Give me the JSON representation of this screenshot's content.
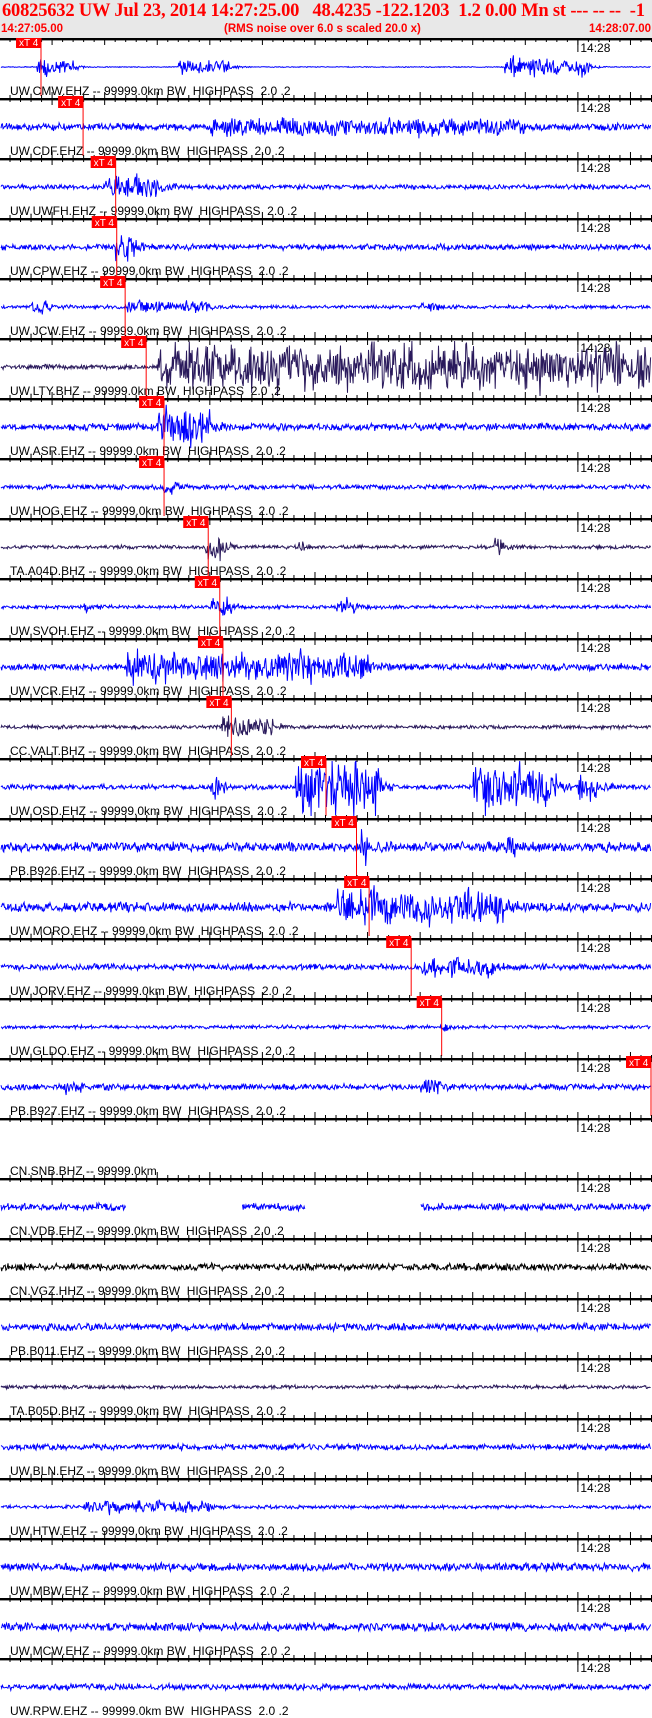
{
  "header": {
    "title": "60825632 UW Jul 23, 2014 14:27:25.00   48.4235 -122.1203  1.2 0.00 Mn st --- -- --  -1",
    "start_time": "14:27:05.00",
    "note": "(RMS noise over 6.0 s scaled 20.0 x)",
    "end_time": "14:28:07.00"
  },
  "chart_data": {
    "type": "line",
    "title": "60825632 UW Jul 23, 2014 14:27:25.00   48.4235 -122.1203  1.2 0.00 Mn st --- -- --  -1",
    "x_axis": {
      "start": "14:27:05.00",
      "end": "14:28:07.00",
      "duration_s": 62,
      "major_tick_s": 5,
      "minor_tick_s": 1,
      "minute_label": "14:28",
      "minute_label_offset_s": 55
    },
    "pick_label": "xT 4",
    "colors": {
      "blue": "#0000ff",
      "dark": "#2a1a5c",
      "black": "#000000",
      "pick": "#ff0000",
      "header_bg": "#e8e8e8"
    },
    "traces": [
      {
        "label": "UW.CMW.EHZ -- 99999.0km BW  HIGHPASS  2.0 .2",
        "color": "blue",
        "noise": 0.4,
        "bursts": [
          [
            3.5,
            7,
            9
          ],
          [
            17,
            22,
            7
          ],
          [
            48,
            56,
            9
          ]
        ],
        "pick_s": 3.9
      },
      {
        "label": "UW.CDF.EHZ -- 99999.0km BW  HIGHPASS  2.0 .2",
        "color": "blue",
        "noise": 3,
        "bursts": [
          [
            20,
            50,
            6
          ]
        ],
        "pick_s": 7.9
      },
      {
        "label": "UW.UWFH.EHZ -- 99999.0km BW  HIGHPASS  2.0 .2",
        "color": "blue",
        "noise": 2,
        "bursts": [
          [
            10,
            16,
            10
          ]
        ],
        "pick_s": 11.0
      },
      {
        "label": "UW.CPW.EHZ -- 99999.0km BW  HIGHPASS  2.0 .2",
        "color": "blue",
        "noise": 2.5,
        "bursts": [
          [
            11,
            13,
            12
          ]
        ],
        "pick_s": 11.1
      },
      {
        "label": "UW.JCW.EHZ -- 99999.0km BW  HIGHPASS  2.0 .2",
        "color": "blue",
        "noise": 1.5,
        "bursts": [
          [
            12,
            20,
            5
          ],
          [
            3,
            5,
            5
          ],
          [
            40,
            42,
            4
          ]
        ],
        "pick_s": 11.9
      },
      {
        "label": "UW.LTY.BHZ -- 99999.0km BW  HIGHPASS  2.0 .2",
        "color": "dark",
        "noise": 2,
        "bursts": [
          [
            15,
            62,
            22
          ]
        ],
        "pick_s": 13.9
      },
      {
        "label": "UW.ASR.EHZ -- 99999.0km BW  HIGHPASS  2.0 .2",
        "color": "blue",
        "noise": 3,
        "bursts": [
          [
            15,
            20,
            15
          ]
        ],
        "pick_s": 15.6
      },
      {
        "label": "UW.HOG.EHZ -- 99999.0km BW  HIGHPASS  2.0 .2",
        "color": "blue",
        "noise": 2,
        "bursts": [
          [
            15.5,
            17,
            10
          ]
        ],
        "pick_s": 15.6
      },
      {
        "label": "TA.A04D.BHZ -- 99999.0km BW  HIGHPASS  2.0 .2",
        "color": "dark",
        "noise": 1.5,
        "bursts": [
          [
            19.5,
            21,
            14
          ],
          [
            28,
            29,
            5
          ],
          [
            47,
            48,
            8
          ]
        ],
        "pick_s": 19.8
      },
      {
        "label": "UW.SVOH.EHZ -- 99999.0km BW  HIGHPASS  2.0 .2",
        "color": "blue",
        "noise": 1.5,
        "bursts": [
          [
            20,
            22,
            10
          ],
          [
            32,
            34,
            6
          ],
          [
            8,
            9,
            4
          ]
        ],
        "pick_s": 20.9
      },
      {
        "label": "UW.VCR.EHZ -- 99999.0km BW  HIGHPASS  2.0 .2",
        "color": "blue",
        "noise": 3,
        "bursts": [
          [
            12,
            35,
            12
          ]
        ],
        "pick_s": 21.2
      },
      {
        "label": "CC.VALT.BHZ -- 99999.0km BW  HIGHPASS  2.0 .2",
        "color": "dark",
        "noise": 1.5,
        "bursts": [
          [
            21,
            26,
            10
          ]
        ],
        "pick_s": 22.0
      },
      {
        "label": "UW.OSD.EHZ -- 99999.0km BW  HIGHPASS  2.0 .2",
        "color": "blue",
        "noise": 2,
        "bursts": [
          [
            20,
            20.6,
            20
          ],
          [
            28,
            36,
            25
          ],
          [
            45,
            53,
            22
          ],
          [
            55,
            57,
            12
          ]
        ],
        "pick_s": 31.0
      },
      {
        "label": "PB.B926.EHZ -- 99999.0km BW  HIGHPASS  2.0 .2",
        "color": "blue",
        "noise": 4,
        "bursts": [
          [
            34,
            35,
            15
          ],
          [
            48,
            49,
            10
          ]
        ],
        "pick_s": 33.9
      },
      {
        "label": "UW.MORO.EHZ -- 99999.0km BW  HIGHPASS  2.0 .2",
        "color": "blue",
        "noise": 4,
        "bursts": [
          [
            32,
            48,
            14
          ]
        ],
        "pick_s": 35.1
      },
      {
        "label": "UW.JORV.EHZ -- 99999.0km BW  HIGHPASS  2.0 .2",
        "color": "blue",
        "noise": 2.5,
        "bursts": [
          [
            40,
            47,
            8
          ]
        ],
        "pick_s": 39.1
      },
      {
        "label": "UW.GLDO.EHZ -- 99999.0km BW  HIGHPASS  2.0 .2",
        "color": "blue",
        "noise": 1.5,
        "bursts": [
          [
            42,
            43,
            4
          ]
        ],
        "pick_s": 42.0
      },
      {
        "label": "PB.B927.EHZ -- 99999.0km BW  HIGHPASS  2.0 .2",
        "color": "blue",
        "noise": 2.5,
        "bursts": [
          [
            40,
            42,
            6
          ],
          [
            6,
            8,
            5
          ]
        ],
        "pick_s": 62
      },
      {
        "label": "CN.SNB.BHZ -- 99999.0km",
        "color": "blue",
        "noise": 0,
        "bursts": [],
        "data_windows": []
      },
      {
        "label": "CN.VDB.EHZ -- 99999.0km BW  HIGHPASS  2.0 .2",
        "color": "blue",
        "noise": 3,
        "bursts": [],
        "data_windows": [
          [
            0,
            12
          ],
          [
            23,
            29
          ],
          [
            40,
            62
          ]
        ]
      },
      {
        "label": "CN.VGZ.HHZ -- 99999.0km BW  HIGHPASS  2.0 .2",
        "color": "black",
        "noise": 3,
        "bursts": []
      },
      {
        "label": "PB.B011.EHZ -- 99999.0km BW  HIGHPASS  2.0 .2",
        "color": "blue",
        "noise": 3,
        "bursts": []
      },
      {
        "label": "TA.B05D.BHZ -- 99999.0km BW  HIGHPASS  2.0 .2",
        "color": "dark",
        "noise": 1.5,
        "bursts": []
      },
      {
        "label": "UW.BLN.EHZ -- 99999.0km BW  HIGHPASS  2.0 .2",
        "color": "blue",
        "noise": 2.5,
        "bursts": []
      },
      {
        "label": "UW.HTW.EHZ -- 99999.0km BW  HIGHPASS  2.0 .2",
        "color": "blue",
        "noise": 1.5,
        "bursts": [
          [
            8,
            20,
            5
          ]
        ]
      },
      {
        "label": "UW.MBW.EHZ -- 99999.0km BW  HIGHPASS  2.0 .2",
        "color": "blue",
        "noise": 3.5,
        "bursts": []
      },
      {
        "label": "UW.MCW.EHZ -- 99999.0km BW  HIGHPASS  2.0 .2",
        "color": "blue",
        "noise": 3.5,
        "bursts": []
      },
      {
        "label": "UW.RPW.EHZ -- 99999.0km BW  HIGHPASS  2.0 .2",
        "color": "blue",
        "noise": 2.5,
        "bursts": []
      }
    ]
  }
}
